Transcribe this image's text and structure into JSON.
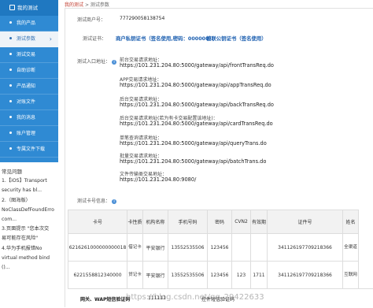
{
  "sidebar": {
    "header": "我的测试",
    "items": [
      {
        "label": "我的产品"
      },
      {
        "label": "测试参数",
        "active": true
      },
      {
        "label": "测试交易"
      },
      {
        "label": "自助诊断"
      },
      {
        "label": "产品通知"
      },
      {
        "label": "对账文件"
      },
      {
        "label": "我的消息"
      },
      {
        "label": "账户管理"
      },
      {
        "label": "专属文件下载"
      }
    ]
  },
  "faq": {
    "title": "常见问题",
    "lines": [
      "1.【iOS】Transport",
      "security has bl...",
      "2.（图海版）",
      "NoClassDefFoundErro",
      "com...",
      "3.页面提示 \"您本次交",
      "易可能存在风险\"",
      "4.华为手机报错No",
      "virtual method bind",
      "()..."
    ]
  },
  "breadcrumb": {
    "root": "我的测试",
    "sep": ">",
    "current": "测试参数"
  },
  "merchant": {
    "label": "测试商户号：",
    "value": "777290058138754"
  },
  "certificate": {
    "label": "测试证书：",
    "link1": "商户私钥证书（签名使用,密码：000000）",
    "link2": "银联公钥证书（签名使用）"
  },
  "endpoints": {
    "label": "测试入口地址：",
    "items": [
      {
        "name": "前台交易请求地址：",
        "url": "https://101.231.204.80:5000/gateway/api/frontTransReq.do"
      },
      {
        "name": "APP交易请求地址：",
        "url": "https://101.231.204.80:5000/gateway/api/appTransReq.do"
      },
      {
        "name": "后台交易请求地址：",
        "url": "https://101.231.204.80:5000/gateway/api/backTransReq.do"
      },
      {
        "name": "后台交易请求地址(若为有卡交易配置该地址)：",
        "url": "https://101.231.204.80:5000/gateway/api/cardTransReq.do"
      },
      {
        "name": "单笔查询请求地址：",
        "url": "https://101.231.204.80:5000/gateway/api/queryTrans.do"
      },
      {
        "name": "批量交易请求地址：",
        "url": "https://101.231.204.80:5000/gateway/api/batchTrans.do"
      },
      {
        "name": "文件传输类交易地址：",
        "url": "https://101.231.204.80:9080/"
      }
    ]
  },
  "cards": {
    "label": "测试卡号信息：",
    "headers": [
      "卡号",
      "卡性质",
      "机构名称",
      "手机号码",
      "密码",
      "CVN2",
      "有效期",
      "证件号",
      "姓名"
    ],
    "rows": [
      [
        "6216261000000000018",
        "借记卡",
        "平安银行",
        "13552535506",
        "123456",
        "",
        "",
        "341126197709218366",
        "全渠道"
      ],
      [
        "6221558812340000",
        "贷记卡",
        "平安银行",
        "13552535506",
        "123456",
        "123",
        "1711",
        "341126197709218366",
        "互联网"
      ]
    ]
  },
  "footer": {
    "row_label": "网关、WAP短信验证码",
    "code": "111111",
    "note": "控件短信验证码"
  },
  "watermark": "https://blog.csdn.net/qq_29422633"
}
